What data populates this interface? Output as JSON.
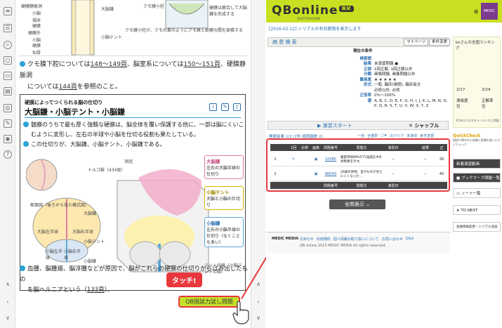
{
  "left": {
    "top_figure": {
      "labels_left": [
        "硬膜静脈洞",
        "小脳",
        "視床",
        "硬膜",
        "硬膜外",
        "小脳",
        "硬膜",
        "仙骨"
      ],
      "label_center": "大脳鎌",
      "label_kumo": "クモ膜小柱",
      "label_tentorium": "小脳テント",
      "note_right": "硬膜は癒合して大脳鎌を形成する",
      "note_bottom": "クモ膜小柱が、クモの巣のようにクモ膜と軟膜の間を架橋する"
    },
    "para1": {
      "text_a": "クモ膜下腔については",
      "ref1": "148～149頁",
      "text_b": "、脳室系については",
      "ref2": "150～151頁",
      "text_c": "、硬膜静脈洞",
      "text_d": "については",
      "ref3": "144頁",
      "text_e": "を参照のこと。"
    },
    "section": {
      "subtitle": "硬膜によってつくられる脳の仕切り",
      "title": "大脳鎌・小脳テント・小脳鎌",
      "b1_line1": "髄膜のうちで最も厚く強靱な硬膜は、脳全体を覆い保護する他に、一部は脳にくいこ",
      "b1_line2": "むように変形し、左右の半球や小脳を仕切る役割も果たしている。",
      "b2": "この仕切りが、大脳鎌、小脳テント、小脳鎌である。",
      "fig_labels": {
        "toruko": "トルコ鞍（434頁）",
        "dounyu": "洞冠",
        "section_title": "断面図（後ろから見た模式図）",
        "daino_left": "大脳左半球",
        "daino_right": "大脳右半球",
        "shono_left": "小脳左半球",
        "shono_right": "小脳右半球",
        "daino_kama": "大脳鎌",
        "shono_tent_lbl": "小脳テント",
        "shono_kama_lbl": "小脳鎌",
        "tent_setsu": "テント切痕（小脳テントの縁）"
      },
      "callouts": [
        {
          "head": "大脳鎌",
          "body": "左右の大脳半球の仕切り"
        },
        {
          "head": "小脳テント",
          "body": "大脳と小脳の仕切り"
        },
        {
          "head": "小脳鎌",
          "body": "左右の小脳半球の仕切り（なくことも多い）"
        }
      ]
    },
    "para2": {
      "line1": "血腫、脳腫瘍、脳浮腫などが原因で、脳がこれらの硬膜の仕切りからはみ出したもの",
      "line2a": "を脳ヘルニアという（",
      "ref": "133頁",
      "line2b": "）。"
    },
    "tap_label": "タッチ!",
    "trial_button": "QB国試力試し問題"
  },
  "right": {
    "logo_text": "QBonline",
    "logo_badge": "国試",
    "logo_sub": "QUESTION BANK",
    "header_user": "様",
    "header_brand": "MEDIC MEDIA",
    "crumb": "[2016-02-12] シリアルの有効期限を表示します",
    "panel_title": "病 患 検 索",
    "btn_mypage": "マイページ",
    "btn_cond": "条件変更",
    "cond_title": "現在の条件",
    "conditions": [
      {
        "k": "検索語",
        "v": ""
      },
      {
        "k": "結果",
        "v": "未演習問題 ●"
      },
      {
        "k": "正誤",
        "v": "1回正解, 1回正解以外"
      },
      {
        "k": "分類",
        "v": "画像問題, 画像問題以外"
      },
      {
        "k": "難易度",
        "v": "★ ★ ★ ★ ★"
      },
      {
        "k": "形式",
        "v": "一般, 臨床(単問), 臨床長文"
      },
      {
        "k": "",
        "v": "必修以外, 必修"
      },
      {
        "k": "正答率",
        "v": "0%～100%"
      },
      {
        "k": "選",
        "v": "A, B, C, D, E, F, G, H, I, J, K, L, M, N, O, P, Q, R, S, T, U, V, W, X, Y, Z"
      }
    ],
    "start_button": "演習スタート",
    "shuffle_button": "シャッフル",
    "result_info": "検索結果 1/2 (2件 経問題数 2)",
    "result_links": [
      "一括",
      "全選択",
      "□★",
      "のクリア",
      "未演習",
      "条件変更"
    ],
    "table_header": [
      "",
      "1回",
      "必修",
      "画像",
      "問題番号",
      "問題文",
      "演習日",
      "",
      "結果",
      "正"
    ],
    "rows": [
      {
        "n": "1",
        "num": "103B5",
        "q": "腹部単純MRIのT1強調正中矢状断像を示す。",
        "date": "--",
        "mark": "--",
        "rate": "26"
      },
      {
        "n": "2",
        "num": "98D43",
        "q": "26歳の男性、首がものが見えにくくなった…",
        "date": "--",
        "mark": "--",
        "rate": "40"
      }
    ],
    "all_button": "全問表示",
    "footer_brand": "MEDIC MEDIA",
    "footer_links": [
      "お知らせ",
      "利用規約",
      "個人情報の取り扱いについて",
      "お問い合わせ",
      "Q&A"
    ],
    "footer_copy": "QB online 2015 MEDIC MEDIA All rights reserved.",
    "side": {
      "rank_title": "kkさんの全国ランキング",
      "date1": "2/17",
      "date2": "2/24",
      "stat1": "達成度",
      "stat2": "正解率",
      "unit": "位",
      "note": "※5年以下の方をランキングに掲載",
      "qc_title": "QuickCheck",
      "qc_note": "国試で問われた知識と医療を使ったデジチェック",
      "btn_new": "新着演習動画",
      "btn_bookmark": "ブックマーク問題一覧",
      "btn_note": "ノート一覧",
      "btn_next": "TO NEXT",
      "btn_member": "会員情報変更・シリアル追加"
    }
  }
}
